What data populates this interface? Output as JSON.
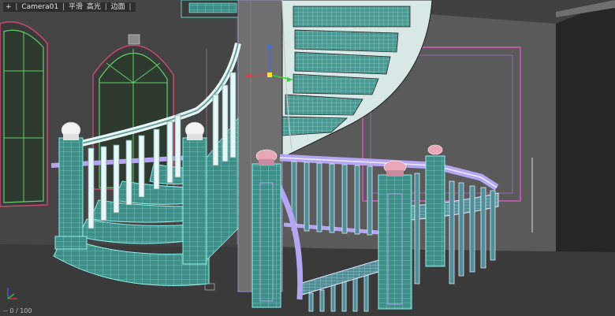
{
  "viewport": {
    "menu_plus": "+",
    "camera_name": "Camera01",
    "shading_mode": "平滑",
    "highlight_mode": "高光",
    "edged_faces": "边面",
    "separator": "|"
  },
  "status": {
    "coords": "-- 0 / 100"
  },
  "colors": {
    "wireframe_cyan": "#8ff0f0",
    "mesh_teal": "#3f8f88",
    "rail_lavender": "#b6a6f2",
    "cap_pink": "#e8a6b6",
    "wall_gray": "#6b6b6b",
    "frame_magenta": "#b65aa6"
  },
  "icons": [
    "gizmo-move-icon",
    "axis-tripod-icon"
  ]
}
